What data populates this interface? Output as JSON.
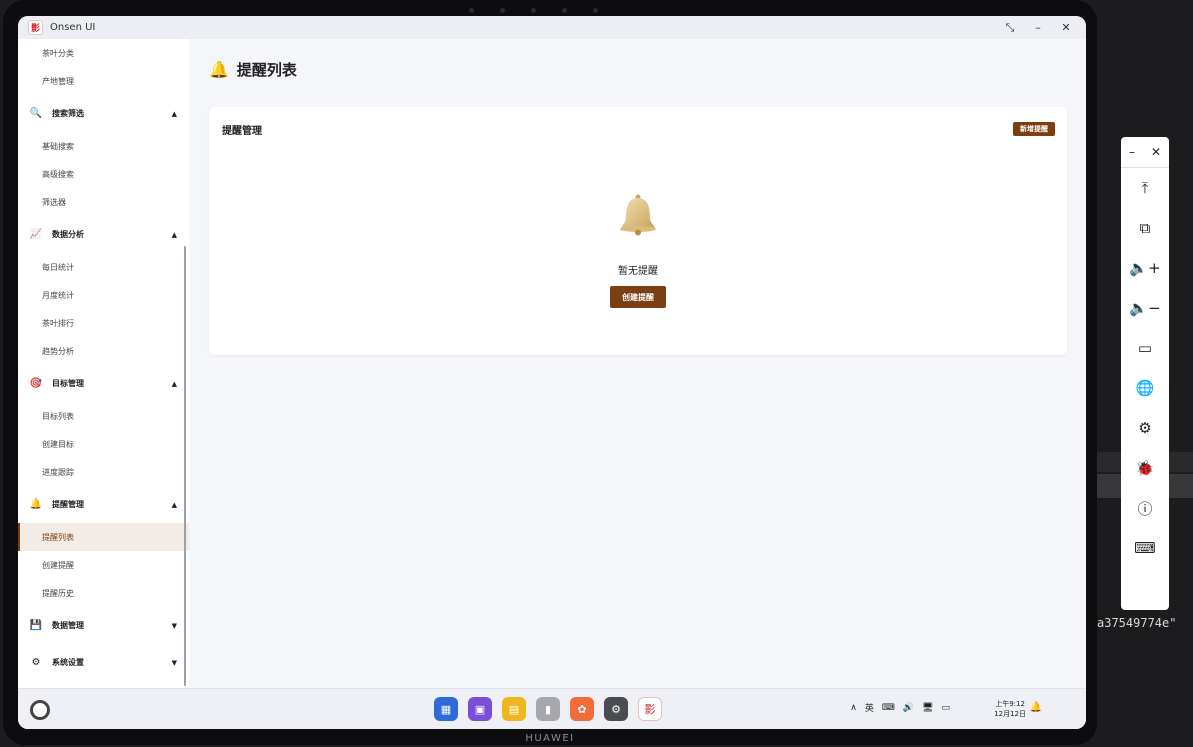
{
  "window": {
    "title": "Onsen UI",
    "logo_text": "影",
    "controls": [
      "⤡",
      "–",
      "✕"
    ]
  },
  "sidebar": {
    "top_items": [
      "茶叶分类",
      "产地管理"
    ],
    "groups": [
      {
        "icon": "🔍",
        "icon_name": "search-icon",
        "label": "搜索筛选",
        "arrow": "▲",
        "items": [
          "基础搜索",
          "高级搜索",
          "筛选器"
        ]
      },
      {
        "icon": "📈",
        "icon_name": "chart-icon",
        "label": "数据分析",
        "arrow": "▲",
        "items": [
          "每日统计",
          "月度统计",
          "茶叶排行",
          "趋势分析"
        ]
      },
      {
        "icon": "🎯",
        "icon_name": "target-icon",
        "label": "目标管理",
        "arrow": "▲",
        "items": [
          "目标列表",
          "创建目标",
          "进度跟踪"
        ]
      },
      {
        "icon": "🔔",
        "icon_name": "bell-icon",
        "label": "提醒管理",
        "arrow": "▲",
        "items": [
          "提醒列表",
          "创建提醒",
          "提醒历史"
        ]
      },
      {
        "icon": "💾",
        "icon_name": "floppy-icon",
        "label": "数据管理",
        "arrow": "▼",
        "items": []
      },
      {
        "icon": "⚙",
        "icon_name": "gear-icon",
        "label": "系统设置",
        "arrow": "▼",
        "items": []
      }
    ],
    "active_item": "提醒列表"
  },
  "main": {
    "page_icon": "🔔",
    "page_title": "提醒列表",
    "card_title": "提醒管理",
    "add_button": "新增提醒",
    "empty_text": "暂无提醒",
    "create_button": "创建提醒"
  },
  "taskbar": {
    "clock_line1": "上午9:12",
    "clock_line2": "12月12日",
    "tray_icons": [
      "∧",
      "英",
      "⌨",
      "🔊",
      "🖥",
      "▭"
    ],
    "tray_bell": "🔔",
    "dock": [
      {
        "name": "app-grid-icon",
        "bg": "#2f6bd8",
        "glyph": "▦"
      },
      {
        "name": "window-icon",
        "bg": "#7a4fd6",
        "glyph": "▣"
      },
      {
        "name": "notes-icon",
        "bg": "#f0b61f",
        "glyph": "▤"
      },
      {
        "name": "trash-icon",
        "bg": "#a6a8ad",
        "glyph": "▮"
      },
      {
        "name": "photos-icon",
        "bg": "#f26b3a",
        "glyph": "✿"
      },
      {
        "name": "settings-icon",
        "bg": "#4a4c52",
        "glyph": "⚙"
      },
      {
        "name": "onsen-app-icon",
        "bg": "#ffffff",
        "glyph": "影"
      }
    ]
  },
  "float_toolbar": {
    "min": "–",
    "close": "✕",
    "items": [
      {
        "name": "upload-top-icon",
        "glyph": "⤒"
      },
      {
        "name": "crop-icon",
        "glyph": "⧉"
      },
      {
        "name": "volume-up-icon",
        "glyph": "🔈+"
      },
      {
        "name": "volume-down-icon",
        "glyph": "🔈−"
      },
      {
        "name": "battery-icon",
        "glyph": "▭"
      },
      {
        "name": "globe-icon",
        "glyph": "🌐"
      },
      {
        "name": "gear-icon",
        "glyph": "⚙"
      },
      {
        "name": "bug-icon",
        "glyph": "🐞"
      },
      {
        "name": "info-icon",
        "glyph": "ⓘ"
      },
      {
        "name": "keyboard-icon",
        "glyph": "⌨"
      }
    ]
  },
  "device_brand": "HUAWEI",
  "background_text": "a37549774e\""
}
